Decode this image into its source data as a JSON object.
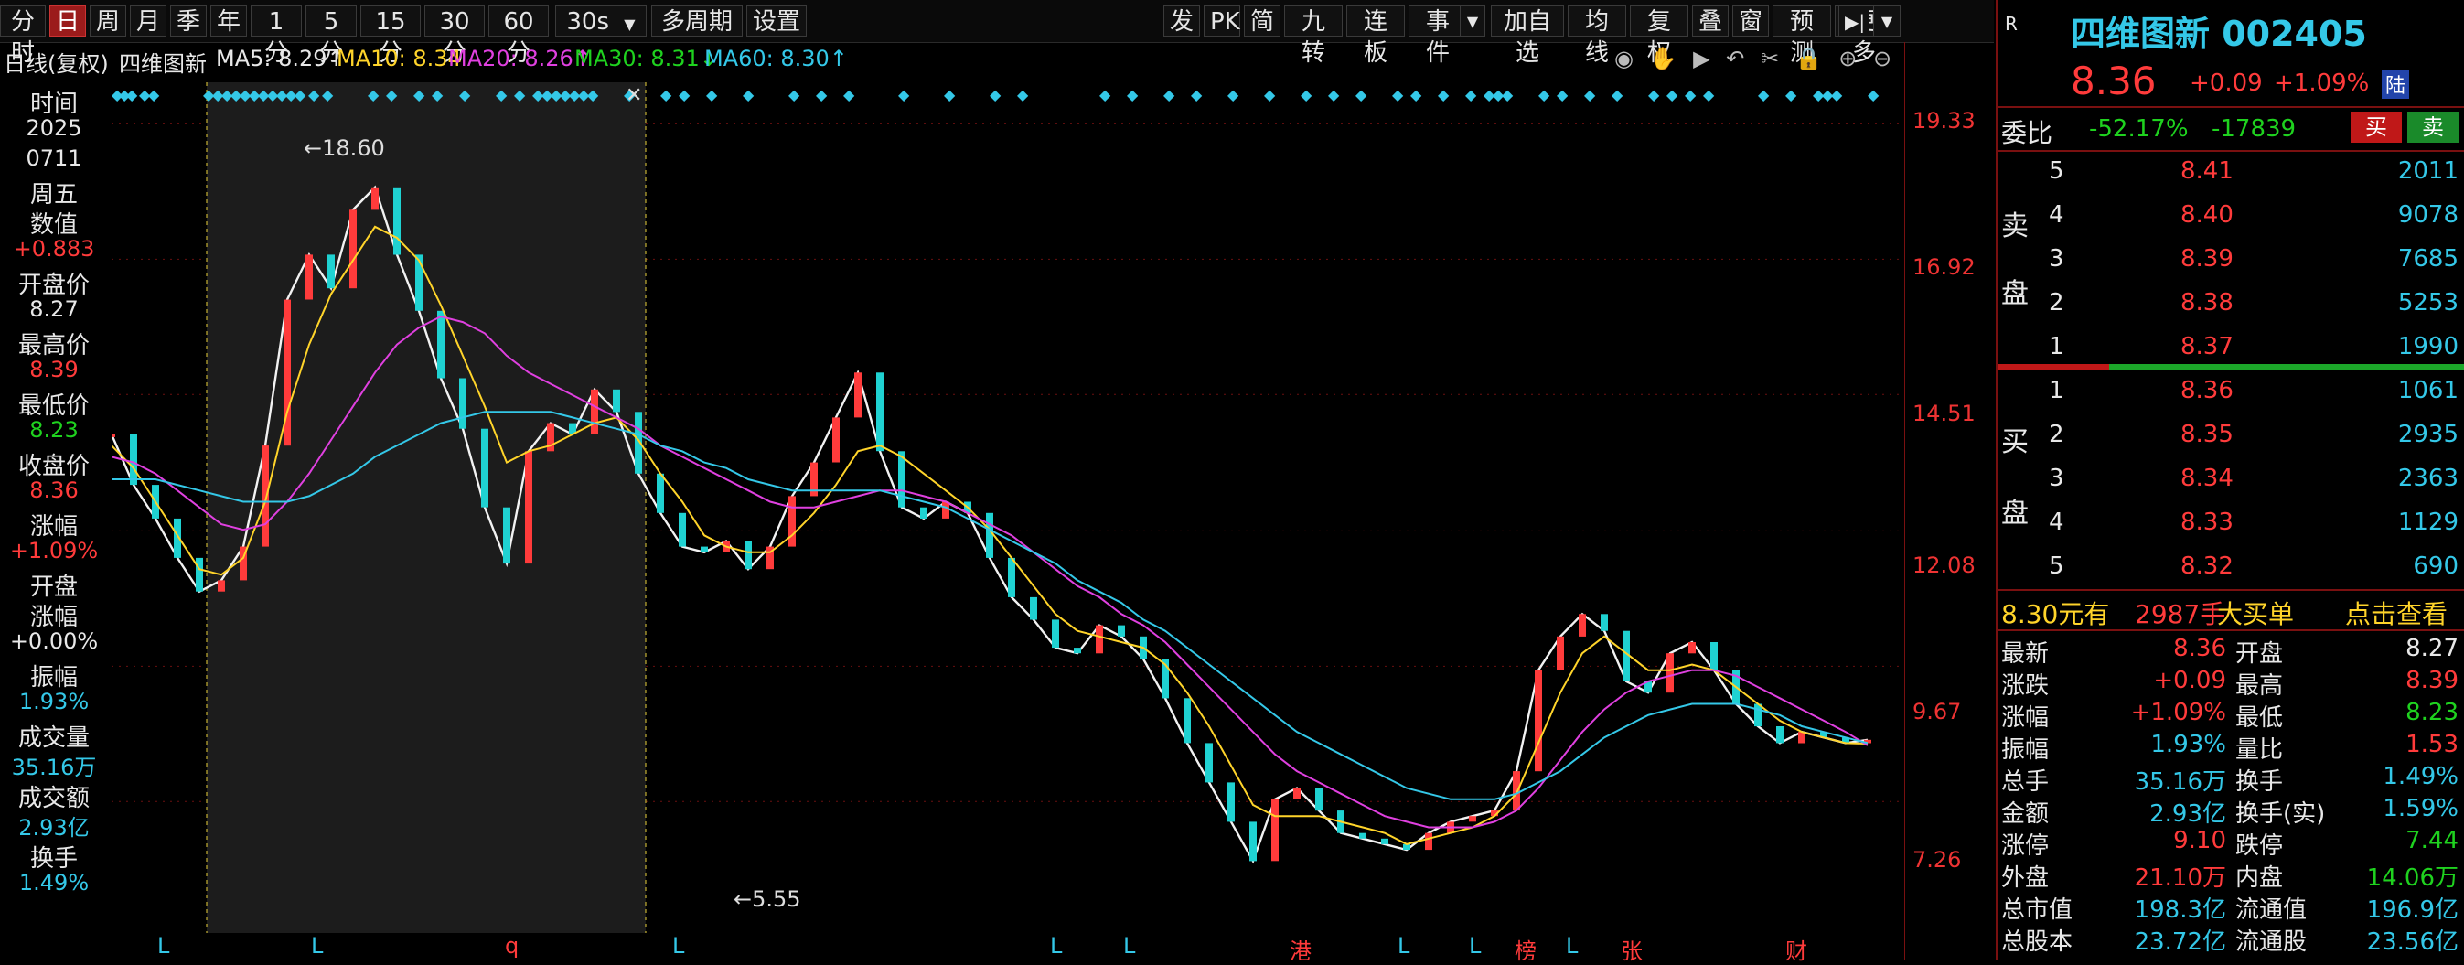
{
  "toolbar": {
    "left": [
      "分时",
      "日",
      "周",
      "月",
      "季",
      "年",
      "1分",
      "5分",
      "15分",
      "30分",
      "60分"
    ],
    "interval": "30s",
    "left2": [
      "多周期",
      "设置"
    ],
    "right": [
      "发",
      "PK",
      "简",
      "九转",
      "连板",
      "事件"
    ],
    "right2": [
      "加自选",
      "均线",
      "复权",
      "叠",
      "窗",
      "预测",
      "更多"
    ]
  },
  "indicators": {
    "label": "日线(复权)",
    "name": "四维图新",
    "ma5": "MA5: 8.29↑",
    "ma10": "MA10: 8.34",
    "ma20": "MA20: 8.26↑",
    "ma30": "MA30: 8.31↓",
    "ma60": "MA60: 8.30↑"
  },
  "left_panel": [
    {
      "label": "时间",
      "value": "2025"
    },
    {
      "label": "",
      "value": "0711"
    },
    {
      "label": "周五",
      "value": ""
    },
    {
      "label": "数值",
      "value": "+0.883"
    },
    {
      "label": "开盘价",
      "value": "8.27"
    },
    {
      "label": "最高价",
      "value": "8.39"
    },
    {
      "label": "最低价",
      "value": "8.23"
    },
    {
      "label": "收盘价",
      "value": "8.36"
    },
    {
      "label": "涨幅",
      "value": "+1.09%"
    },
    {
      "label": "开盘",
      "value": ""
    },
    {
      "label": "涨幅",
      "value": "+0.00%"
    },
    {
      "label": "振幅",
      "value": "1.93%"
    },
    {
      "label": "成交量",
      "value": "35.16万"
    },
    {
      "label": "成交额",
      "value": "2.93亿"
    },
    {
      "label": "换手",
      "value": "1.49%"
    }
  ],
  "axis_labels": [
    "19.33",
    "16.92",
    "14.51",
    "12.08",
    "9.67",
    "7.26"
  ],
  "chart_annotations": {
    "high": "18.60",
    "low": "5.55"
  },
  "bottom_markers": [
    "L",
    "L",
    "q",
    "L",
    "L",
    "L",
    "港",
    "L",
    "L",
    "榜",
    "L",
    "张",
    "财"
  ],
  "chart_data": {
    "type": "line",
    "title": "",
    "ylim": [
      5.0,
      19.5
    ],
    "ytick_labels": [
      "19.33",
      "16.92",
      "14.51",
      "12.08",
      "9.67",
      "7.26"
    ],
    "series": [
      {
        "name": "Close",
        "values": [
          13.8,
          12.9,
          12.3,
          11.6,
          11.0,
          11.2,
          11.8,
          13.6,
          16.2,
          17.0,
          16.4,
          17.8,
          18.2,
          17.0,
          16.0,
          14.8,
          13.9,
          12.5,
          11.5,
          13.5,
          14.0,
          13.8,
          14.6,
          14.2,
          13.1,
          12.4,
          11.8,
          11.7,
          11.9,
          11.4,
          11.8,
          12.7,
          13.3,
          14.1,
          14.9,
          13.5,
          12.5,
          12.3,
          12.6,
          12.4,
          11.6,
          10.9,
          10.5,
          10.0,
          9.9,
          10.4,
          10.2,
          9.8,
          9.1,
          8.3,
          7.6,
          6.9,
          6.2,
          7.3,
          7.5,
          7.1,
          6.7,
          6.6,
          6.5,
          6.4,
          6.7,
          6.9,
          7.0,
          7.1,
          7.8,
          9.6,
          10.2,
          10.6,
          10.3,
          9.4,
          9.2,
          9.9,
          10.1,
          9.6,
          9.0,
          8.6,
          8.3,
          8.5,
          8.4,
          8.3,
          8.36
        ]
      },
      {
        "name": "MA5",
        "values": [
          13.6,
          13.2,
          12.6,
          12.0,
          11.4,
          11.3,
          11.6,
          12.6,
          14.2,
          15.4,
          16.3,
          16.9,
          17.5,
          17.3,
          16.9,
          16.1,
          15.2,
          14.3,
          13.3,
          13.5,
          13.6,
          13.8,
          14.0,
          14.1,
          13.7,
          13.1,
          12.6,
          12.0,
          11.8,
          11.7,
          11.7,
          12.0,
          12.4,
          12.9,
          13.5,
          13.6,
          13.4,
          13.1,
          12.8,
          12.5,
          12.1,
          11.6,
          11.1,
          10.6,
          10.3,
          10.2,
          10.1,
          10.0,
          9.7,
          9.2,
          8.6,
          7.9,
          7.2,
          7.0,
          7.0,
          7.0,
          6.9,
          6.8,
          6.7,
          6.5,
          6.6,
          6.7,
          6.8,
          7.0,
          7.4,
          8.3,
          9.2,
          9.9,
          10.2,
          9.9,
          9.6,
          9.6,
          9.7,
          9.6,
          9.3,
          9.0,
          8.7,
          8.5,
          8.4,
          8.3,
          8.29
        ]
      },
      {
        "name": "MA20",
        "values": [
          13.4,
          13.3,
          13.1,
          12.8,
          12.5,
          12.2,
          12.1,
          12.2,
          12.6,
          13.1,
          13.7,
          14.3,
          14.9,
          15.4,
          15.7,
          15.9,
          15.8,
          15.6,
          15.2,
          14.9,
          14.7,
          14.5,
          14.3,
          14.1,
          13.9,
          13.6,
          13.4,
          13.2,
          13.0,
          12.8,
          12.6,
          12.5,
          12.5,
          12.6,
          12.7,
          12.8,
          12.8,
          12.7,
          12.6,
          12.4,
          12.2,
          12.0,
          11.7,
          11.4,
          11.1,
          10.9,
          10.6,
          10.4,
          10.1,
          9.7,
          9.3,
          8.9,
          8.5,
          8.1,
          7.8,
          7.6,
          7.4,
          7.2,
          7.0,
          6.9,
          6.8,
          6.8,
          6.8,
          6.9,
          7.1,
          7.5,
          8.0,
          8.5,
          8.9,
          9.2,
          9.4,
          9.5,
          9.6,
          9.6,
          9.5,
          9.3,
          9.1,
          8.9,
          8.7,
          8.5,
          8.26
        ]
      },
      {
        "name": "MA60",
        "values": [
          13.0,
          13.0,
          13.0,
          12.9,
          12.8,
          12.7,
          12.6,
          12.6,
          12.6,
          12.7,
          12.9,
          13.1,
          13.4,
          13.6,
          13.8,
          14.0,
          14.1,
          14.2,
          14.2,
          14.2,
          14.2,
          14.1,
          14.0,
          13.9,
          13.8,
          13.6,
          13.5,
          13.3,
          13.2,
          13.0,
          12.9,
          12.8,
          12.8,
          12.8,
          12.8,
          12.8,
          12.7,
          12.6,
          12.5,
          12.3,
          12.1,
          11.9,
          11.7,
          11.5,
          11.2,
          11.0,
          10.8,
          10.5,
          10.3,
          10.0,
          9.7,
          9.4,
          9.1,
          8.8,
          8.5,
          8.3,
          8.1,
          7.9,
          7.7,
          7.5,
          7.4,
          7.3,
          7.3,
          7.3,
          7.4,
          7.6,
          7.8,
          8.1,
          8.4,
          8.6,
          8.8,
          8.9,
          9.0,
          9.0,
          9.0,
          8.9,
          8.8,
          8.6,
          8.5,
          8.4,
          8.3
        ]
      }
    ],
    "grid": false
  },
  "right_panel": {
    "tag": "R",
    "title": "四维图新 002405",
    "price": "8.36",
    "change": "+0.09",
    "pct": "+1.09%",
    "lu": "陆",
    "weibi_label": "委比",
    "weibi_pct": "-52.17%",
    "weibi_val": "-17839",
    "buy_btn": "买",
    "sell_btn": "卖",
    "sell_label": [
      "卖",
      "盘"
    ],
    "buy_label": [
      "买",
      "盘"
    ],
    "asks": [
      {
        "n": "5",
        "p": "8.41",
        "v": "2011"
      },
      {
        "n": "4",
        "p": "8.40",
        "v": "9078"
      },
      {
        "n": "3",
        "p": "8.39",
        "v": "7685"
      },
      {
        "n": "2",
        "p": "8.38",
        "v": "5253"
      },
      {
        "n": "1",
        "p": "8.37",
        "v": "1990"
      }
    ],
    "bids": [
      {
        "n": "1",
        "p": "8.36",
        "v": "1061"
      },
      {
        "n": "2",
        "p": "8.35",
        "v": "2935"
      },
      {
        "n": "3",
        "p": "8.34",
        "v": "2363"
      },
      {
        "n": "4",
        "p": "8.33",
        "v": "1129"
      },
      {
        "n": "5",
        "p": "8.32",
        "v": "690"
      }
    ],
    "big_order": {
      "price": "8.30元有",
      "qty": "2987手",
      "type": "大买单",
      "action": "点击查看"
    },
    "stats": [
      {
        "l1": "最新",
        "v1": "8.36",
        "c1": "red",
        "l2": "开盘",
        "v2": "8.27",
        "c2": "white"
      },
      {
        "l1": "涨跌",
        "v1": "+0.09",
        "c1": "red",
        "l2": "最高",
        "v2": "8.39",
        "c2": "red"
      },
      {
        "l1": "涨幅",
        "v1": "+1.09%",
        "c1": "red",
        "l2": "最低",
        "v2": "8.23",
        "c2": "green"
      },
      {
        "l1": "振幅",
        "v1": "1.93%",
        "c1": "cyan",
        "l2": "量比",
        "v2": "1.53",
        "c2": "red"
      },
      {
        "l1": "总手",
        "v1": "35.16万",
        "c1": "cyan",
        "l2": "换手",
        "v2": "1.49%",
        "c2": "cyan"
      },
      {
        "l1": "金额",
        "v1": "2.93亿",
        "c1": "cyan",
        "l2": "换手(实)",
        "v2": "1.59%",
        "c2": "cyan"
      },
      {
        "l1": "涨停",
        "v1": "9.10",
        "c1": "red",
        "l2": "跌停",
        "v2": "7.44",
        "c2": "green"
      },
      {
        "l1": "外盘",
        "v1": "21.10万",
        "c1": "red",
        "l2": "内盘",
        "v2": "14.06万",
        "c2": "green"
      },
      {
        "l1": "总市值",
        "v1": "198.3亿",
        "c1": "cyan",
        "l2": "流通值",
        "v2": "196.9亿",
        "c2": "cyan"
      },
      {
        "l1": "总股本",
        "v1": "23.72亿",
        "c1": "cyan",
        "l2": "流通股",
        "v2": "23.56亿",
        "c2": "cyan"
      }
    ]
  }
}
